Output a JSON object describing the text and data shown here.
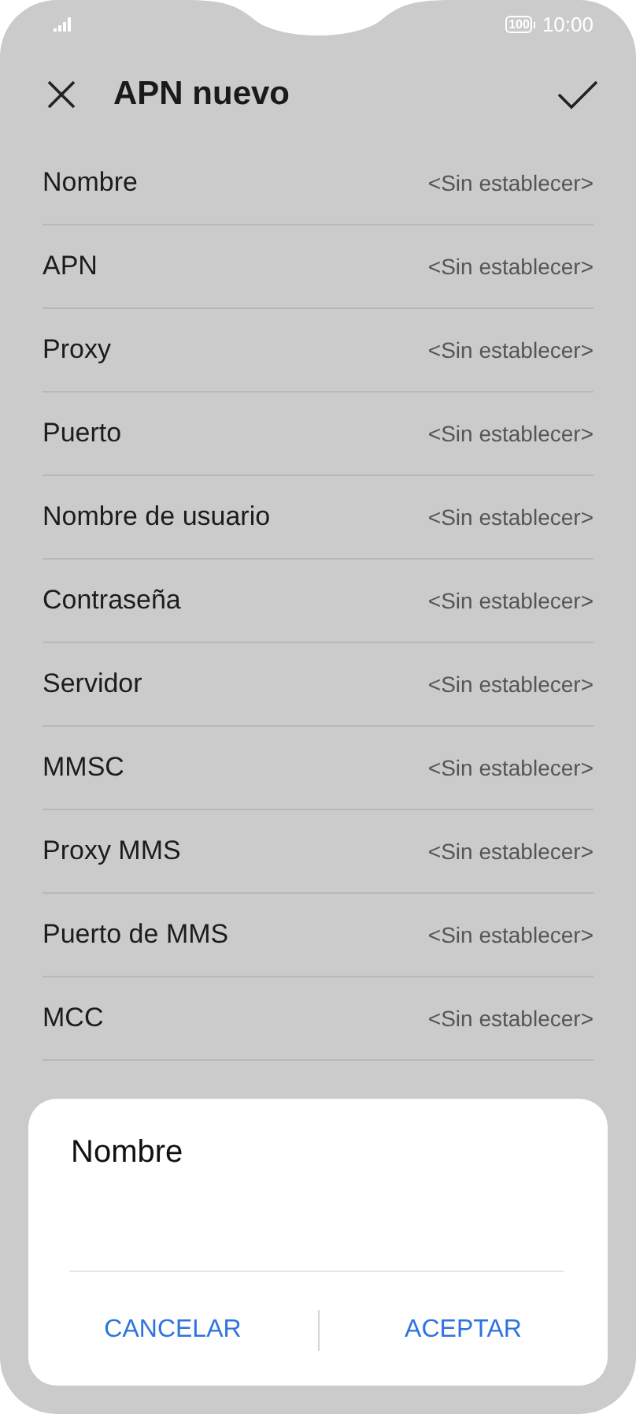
{
  "status_bar": {
    "battery": "100",
    "time": "10:00"
  },
  "app_bar": {
    "title": "APN nuevo"
  },
  "settings": [
    {
      "label": "Nombre",
      "value": "<Sin establecer>"
    },
    {
      "label": "APN",
      "value": "<Sin establecer>"
    },
    {
      "label": "Proxy",
      "value": "<Sin establecer>"
    },
    {
      "label": "Puerto",
      "value": "<Sin establecer>"
    },
    {
      "label": "Nombre de usuario",
      "value": "<Sin establecer>"
    },
    {
      "label": "Contraseña",
      "value": "<Sin establecer>"
    },
    {
      "label": "Servidor",
      "value": "<Sin establecer>"
    },
    {
      "label": "MMSC",
      "value": "<Sin establecer>"
    },
    {
      "label": "Proxy MMS",
      "value": "<Sin establecer>"
    },
    {
      "label": "Puerto de MMS",
      "value": "<Sin establecer>"
    },
    {
      "label": "MCC",
      "value": "<Sin establecer>"
    }
  ],
  "dialog": {
    "title": "Nombre",
    "buttons": [
      "CANCELAR",
      "ACEPTAR"
    ]
  }
}
